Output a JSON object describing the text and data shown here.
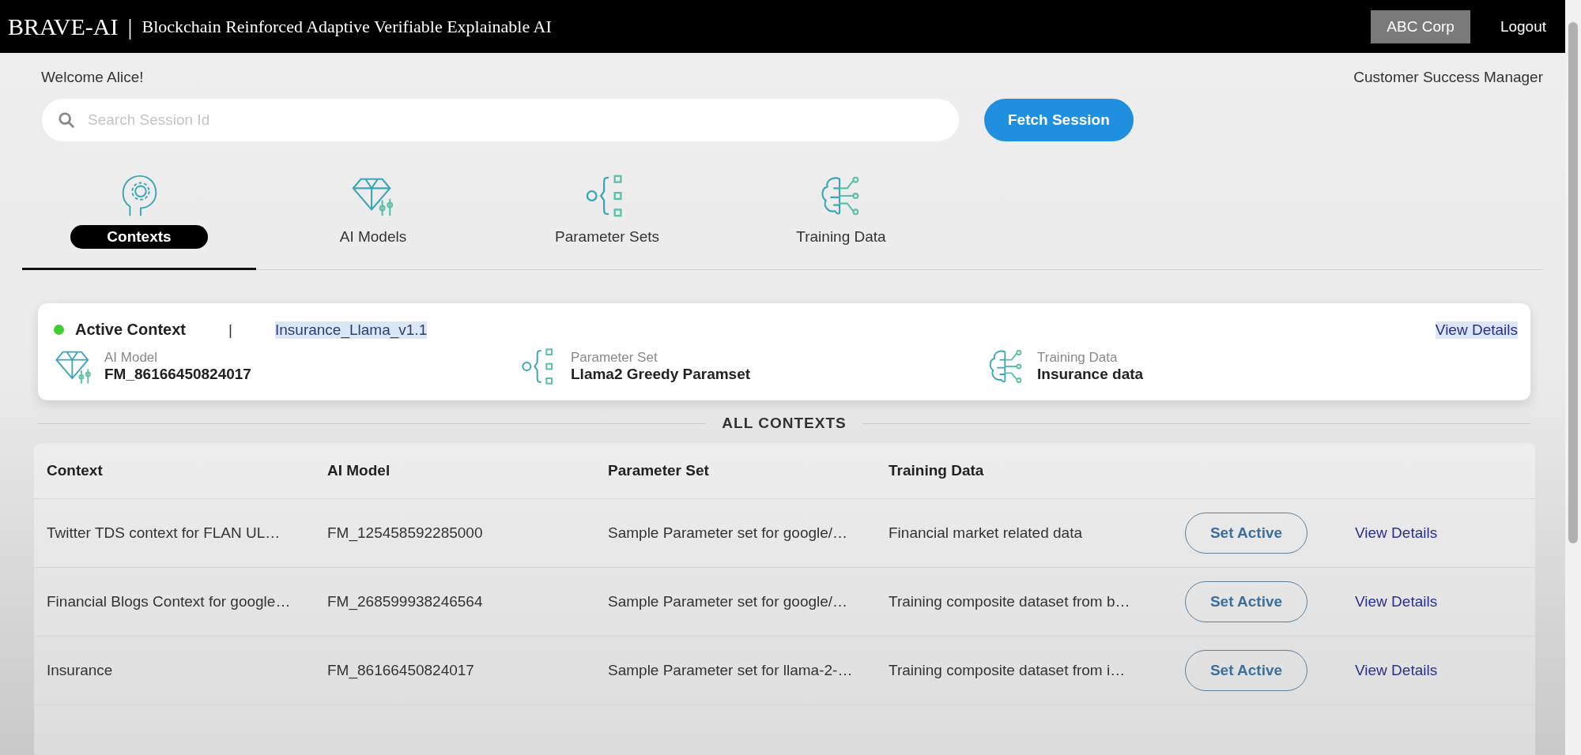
{
  "header": {
    "brand": "BRAVE-AI",
    "separator": "|",
    "subtitle": "Blockchain Reinforced Adaptive Verifiable Explainable AI",
    "org": "ABC Corp",
    "logout": "Logout"
  },
  "welcome": "Welcome Alice!",
  "role": "Customer Success Manager",
  "search": {
    "placeholder": "Search Session Id",
    "button": "Fetch Session"
  },
  "tabs": [
    {
      "label": "Contexts",
      "kind": "contexts",
      "selected": true
    },
    {
      "label": "AI Models",
      "kind": "models",
      "selected": false
    },
    {
      "label": "Parameter Sets",
      "kind": "params",
      "selected": false
    },
    {
      "label": "Training Data",
      "kind": "training",
      "selected": false
    }
  ],
  "active_context": {
    "title": "Active Context",
    "color": "#3ccf2e",
    "separator": "|",
    "name": "Insurance_Llama_v1.1",
    "name_highlighted": true,
    "view_details": "View Details",
    "view_details_highlighted": true,
    "items": [
      {
        "kind": "models",
        "label": "AI Model",
        "value": "FM_86166450824017"
      },
      {
        "kind": "params",
        "label": "Parameter Set",
        "value": "Llama2 Greedy Paramset"
      },
      {
        "kind": "training",
        "label": "Training Data",
        "value": "Insurance data"
      }
    ]
  },
  "all_contexts": {
    "title": "ALL CONTEXTS",
    "columns": [
      "Context",
      "AI Model",
      "Parameter Set",
      "Training Data"
    ],
    "rows": [
      {
        "cells": [
          "Twitter TDS context for FLAN UL…",
          "FM_125458592285000",
          "Sample Parameter set for google/…",
          "Financial market related data"
        ],
        "action": "Set Active",
        "link": "View Details"
      },
      {
        "cells": [
          "Financial Blogs Context for google…",
          "FM_268599938246564",
          "Sample Parameter set for google/…",
          "Training composite dataset from b…"
        ],
        "action": "Set Active",
        "link": "View Details"
      },
      {
        "cells": [
          "Insurance",
          "FM_86166450824017",
          "Sample Parameter set for llama-2-…",
          "Training composite dataset from i…"
        ],
        "action": "Set Active",
        "link": "View Details"
      }
    ]
  }
}
